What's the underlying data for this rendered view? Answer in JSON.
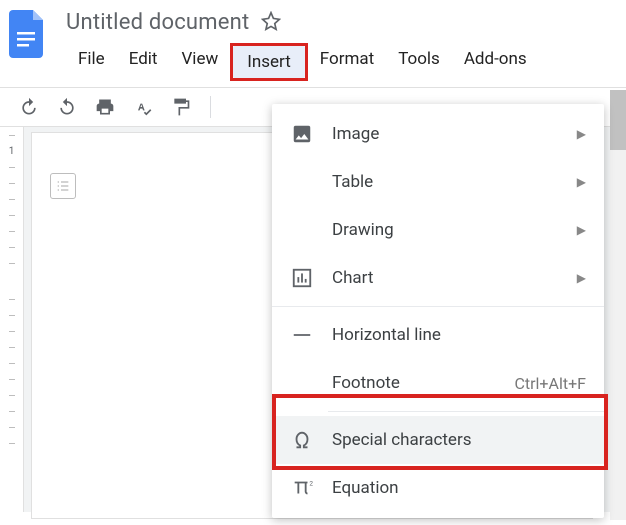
{
  "header": {
    "title": "Untitled document"
  },
  "menubar": {
    "items": [
      "File",
      "Edit",
      "View",
      "Insert",
      "Format",
      "Tools",
      "Add-ons"
    ],
    "active_index": 3
  },
  "ruler": {
    "label": "1"
  },
  "dropdown": {
    "items": [
      {
        "icon": "image-icon",
        "label": "Image",
        "has_submenu": true
      },
      {
        "icon": "",
        "label": "Table",
        "has_submenu": true
      },
      {
        "icon": "",
        "label": "Drawing",
        "has_submenu": true
      },
      {
        "icon": "chart-icon",
        "label": "Chart",
        "has_submenu": true
      },
      {
        "sep": true
      },
      {
        "icon": "hline-icon",
        "label": "Horizontal line"
      },
      {
        "icon": "",
        "label": "Footnote",
        "shortcut": "Ctrl+Alt+F"
      },
      {
        "sep_partial": true
      },
      {
        "icon": "omega-icon",
        "label": "Special characters",
        "highlighted": true
      },
      {
        "icon": "pi-icon",
        "label": "Equation"
      }
    ]
  }
}
